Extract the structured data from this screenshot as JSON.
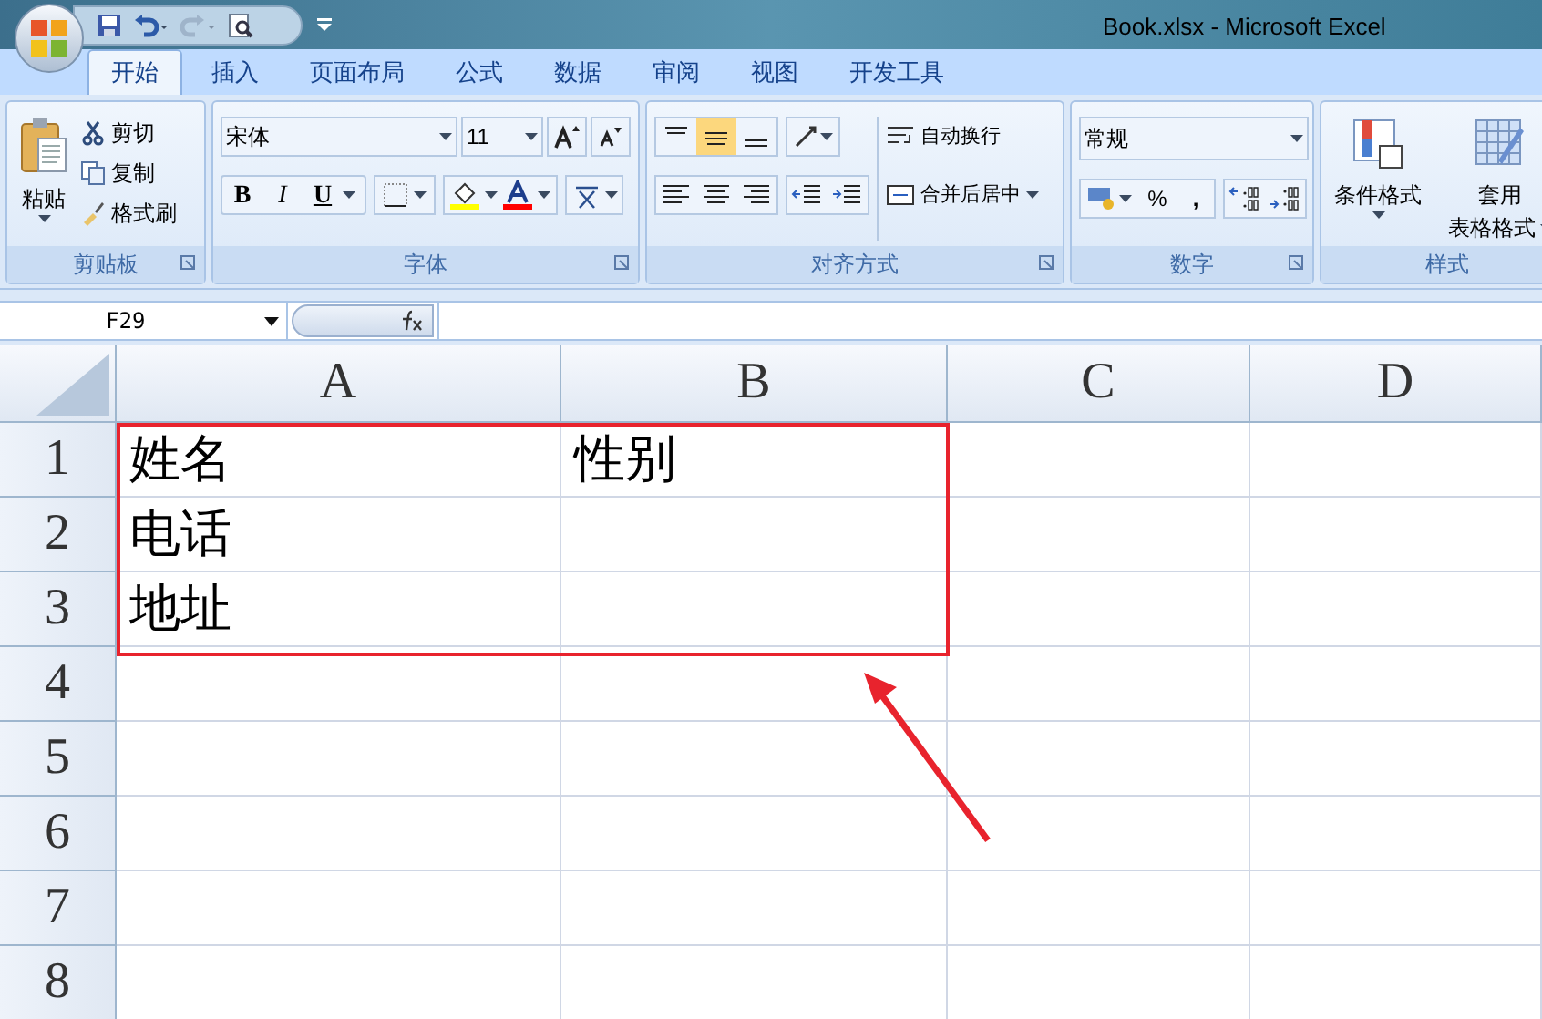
{
  "window": {
    "title": "Book.xlsx - Microsoft Excel"
  },
  "tabs": [
    {
      "label": "开始",
      "selected": true
    },
    {
      "label": "插入",
      "selected": false
    },
    {
      "label": "页面布局",
      "selected": false
    },
    {
      "label": "公式",
      "selected": false
    },
    {
      "label": "数据",
      "selected": false
    },
    {
      "label": "审阅",
      "selected": false
    },
    {
      "label": "视图",
      "selected": false
    },
    {
      "label": "开发工具",
      "selected": false
    }
  ],
  "clipboard": {
    "paste": "粘贴",
    "cut": "剪切",
    "copy": "复制",
    "format_painter": "格式刷",
    "label": "剪贴板"
  },
  "font": {
    "name": "宋体",
    "size": "11",
    "bold": "B",
    "italic": "I",
    "underline": "U",
    "label": "字体"
  },
  "alignment": {
    "wrap": "自动换行",
    "merge": "合并后居中",
    "label": "对齐方式"
  },
  "number": {
    "format": "常规",
    "percent": "%",
    "comma": ",",
    "label": "数字"
  },
  "styles": {
    "conditional": "条件格式",
    "table_format_1": "套用",
    "table_format_2": "表格格式",
    "label": "样式"
  },
  "formula_bar": {
    "name_box": "F29"
  },
  "sheet": {
    "columns": [
      "A",
      "B",
      "C",
      "D"
    ],
    "rows": [
      {
        "number": "1",
        "cells": [
          "姓名",
          "性别",
          "",
          ""
        ]
      },
      {
        "number": "2",
        "cells": [
          "电话",
          "",
          "",
          ""
        ]
      },
      {
        "number": "3",
        "cells": [
          "地址",
          "",
          "",
          ""
        ]
      },
      {
        "number": "4",
        "cells": [
          "",
          "",
          "",
          ""
        ]
      },
      {
        "number": "5",
        "cells": [
          "",
          "",
          "",
          ""
        ]
      },
      {
        "number": "6",
        "cells": [
          "",
          "",
          "",
          ""
        ]
      },
      {
        "number": "7",
        "cells": [
          "",
          "",
          "",
          ""
        ]
      },
      {
        "number": "8",
        "cells": [
          "",
          "",
          "",
          ""
        ]
      }
    ]
  }
}
